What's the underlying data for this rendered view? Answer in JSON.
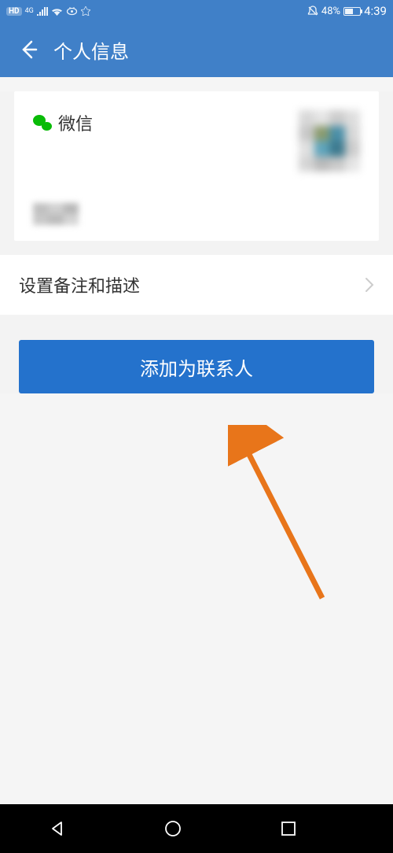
{
  "status_bar": {
    "hd_label": "HD",
    "signal_label": "4G",
    "battery_percent": "48%",
    "time": "4:39"
  },
  "header": {
    "title": "个人信息"
  },
  "profile": {
    "source_label": "微信"
  },
  "settings": {
    "remark_label": "设置备注和描述"
  },
  "actions": {
    "add_contact_label": "添加为联系人"
  }
}
